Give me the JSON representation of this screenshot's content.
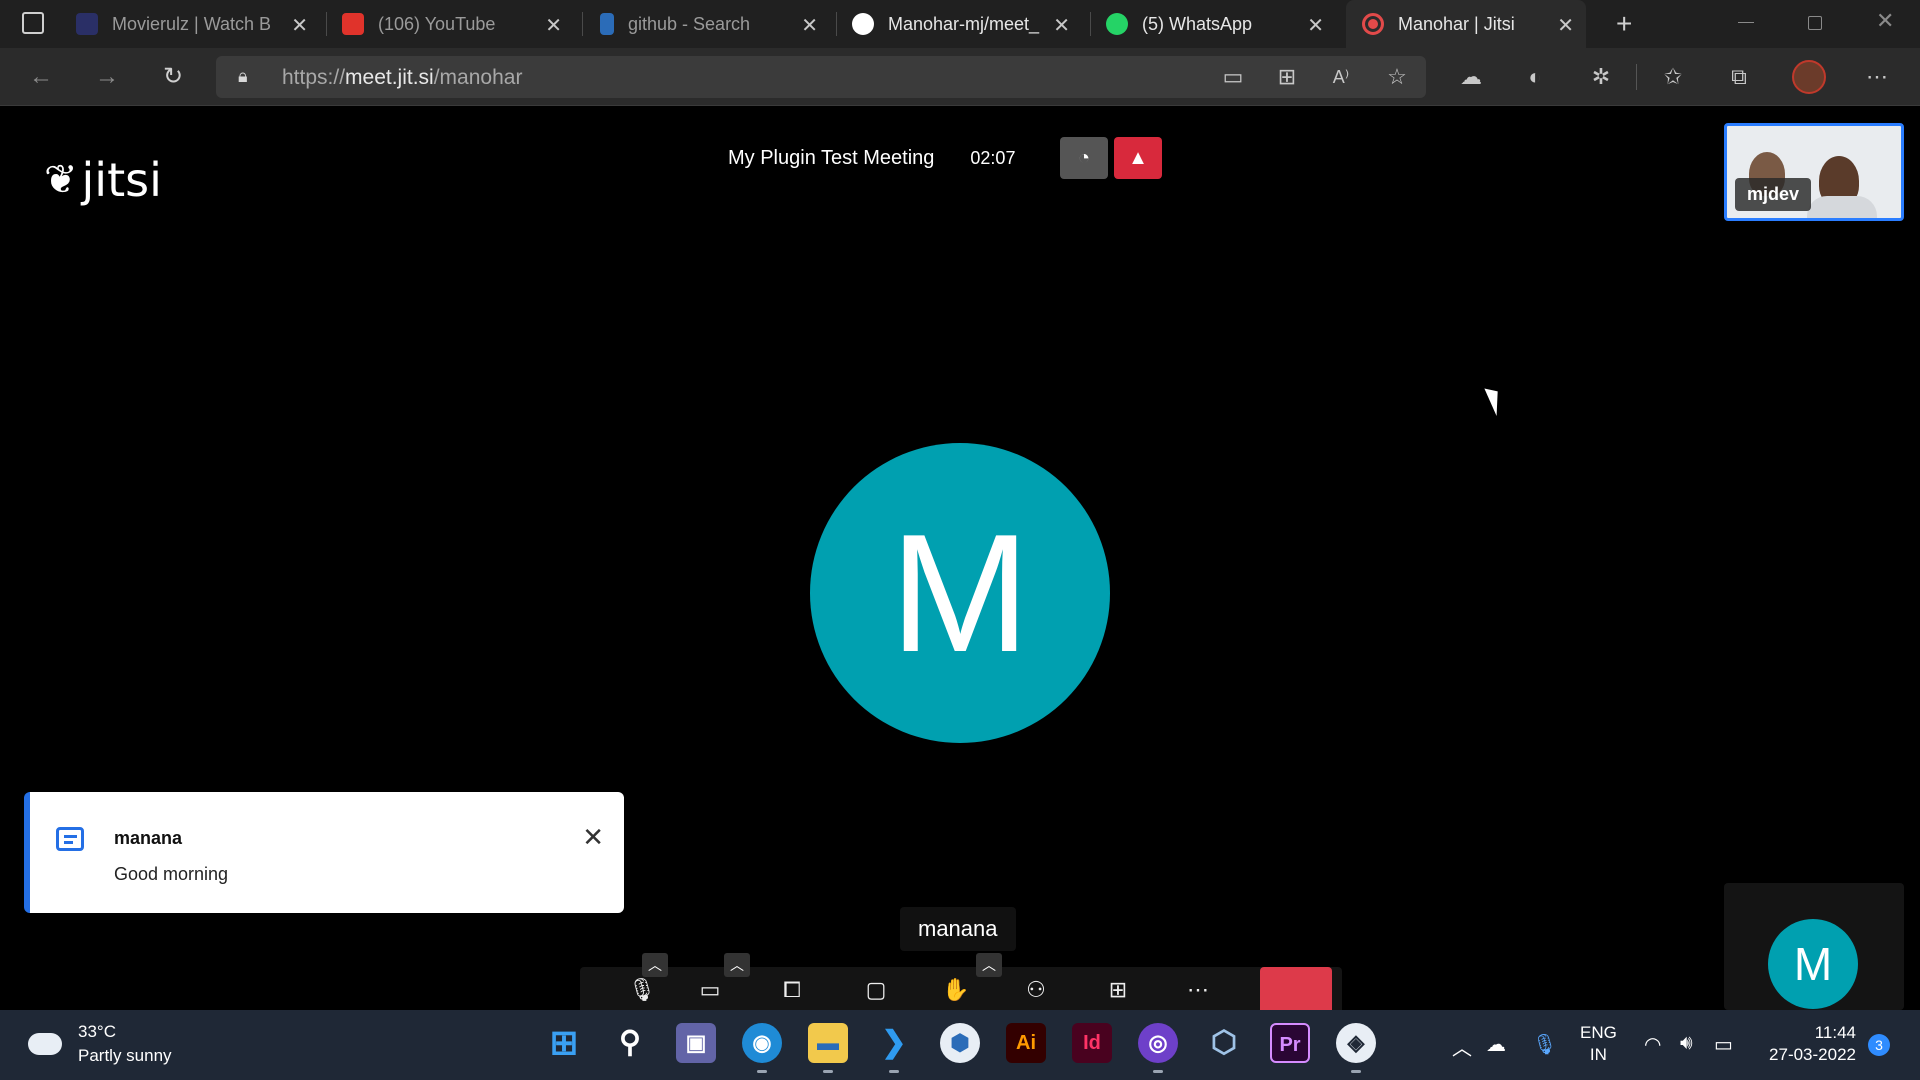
{
  "browser": {
    "tabs": [
      {
        "title": "Movierulz | Watch B",
        "favicon": "movierulz-icon",
        "color": "#2a2f66"
      },
      {
        "title": "(106) YouTube",
        "favicon": "youtube-icon",
        "color": "#e0332b"
      },
      {
        "title": "github - Search",
        "favicon": "bing-icon",
        "color": "#2b6cb8"
      },
      {
        "title": "Manohar-mj/meet_",
        "favicon": "github-icon",
        "color": "#ffffff"
      },
      {
        "title": "(5) WhatsApp",
        "favicon": "whatsapp-icon",
        "color": "#25d366"
      },
      {
        "title": "Manohar | Jitsi",
        "favicon": "recording-icon",
        "color": "#e24a4a"
      }
    ],
    "url_prefix": "https://",
    "url_host": "meet.jit.si",
    "url_path": "/manohar"
  },
  "meeting": {
    "logo_text": "jitsi",
    "subject": "My Plugin Test Meeting",
    "timer": "02:07",
    "remote_participant": "mjdev",
    "dominant_initial": "M",
    "dominant_name": "manana",
    "self_initial": "M"
  },
  "notification": {
    "sender": "manana",
    "message": "Good morning"
  },
  "taskbar": {
    "temperature": "33°C",
    "condition": "Partly sunny",
    "lang_top": "ENG",
    "lang_bottom": "IN",
    "time": "11:44",
    "date": "27-03-2022",
    "notification_count": "3",
    "apps": [
      {
        "name": "windows-start-icon",
        "glyph": "⊞",
        "color": "#3aa0f3"
      },
      {
        "name": "search-icon",
        "glyph": "⚲",
        "color": "#1f2836"
      },
      {
        "name": "teams-icon",
        "glyph": "▣",
        "color": "#6264a7"
      },
      {
        "name": "edge-icon",
        "glyph": "◉",
        "color": "#1f8bd6"
      },
      {
        "name": "file-explorer-icon",
        "glyph": "▬",
        "color": "#f2c94c"
      },
      {
        "name": "vscode-icon",
        "glyph": "❯",
        "color": "#1f7ad4"
      },
      {
        "name": "app-icon",
        "glyph": "⬢",
        "color": "#e8eef5"
      },
      {
        "name": "illustrator-icon",
        "glyph": "Ai",
        "color": "#330000"
      },
      {
        "name": "indesign-icon",
        "glyph": "Id",
        "color": "#49021f"
      },
      {
        "name": "github-desktop-icon",
        "glyph": "◎",
        "color": "#6e40c9"
      },
      {
        "name": "virtualbox-icon",
        "glyph": "⬡",
        "color": "#1f2836"
      },
      {
        "name": "premiere-icon",
        "glyph": "Pr",
        "color": "#2a0634"
      },
      {
        "name": "jitsi-app-icon",
        "glyph": "◈",
        "color": "#e8eef5"
      }
    ]
  }
}
